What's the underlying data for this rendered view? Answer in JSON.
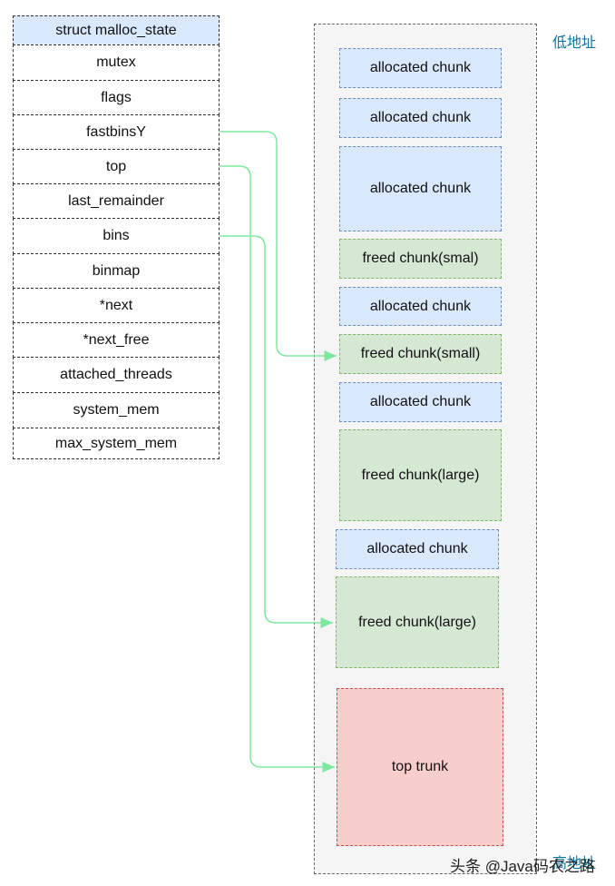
{
  "struct": {
    "fields": [
      "struct malloc_state",
      "mutex",
      "flags",
      "fastbinsY",
      "top",
      "last_remainder",
      "bins",
      "binmap",
      "*next",
      "*next_free",
      "attached_threads",
      "system_mem",
      "max_system_mem"
    ]
  },
  "heap": {
    "low_label": "低地址",
    "high_label": "高地址",
    "chunks": [
      "allocated chunk",
      "allocated chunk",
      "allocated chunk",
      "freed chunk(smal)",
      "allocated chunk",
      "freed chunk(small)",
      "allocated chunk",
      "freed chunk(large)",
      "allocated chunk",
      "freed chunk(large)",
      "top trunk"
    ]
  },
  "watermark": "头条 @Java码农之路",
  "colors": {
    "allocated": "#dae8fc",
    "freed": "#d5e8d4",
    "top": "#f8cecc",
    "arrow": "#7ee8a0"
  }
}
